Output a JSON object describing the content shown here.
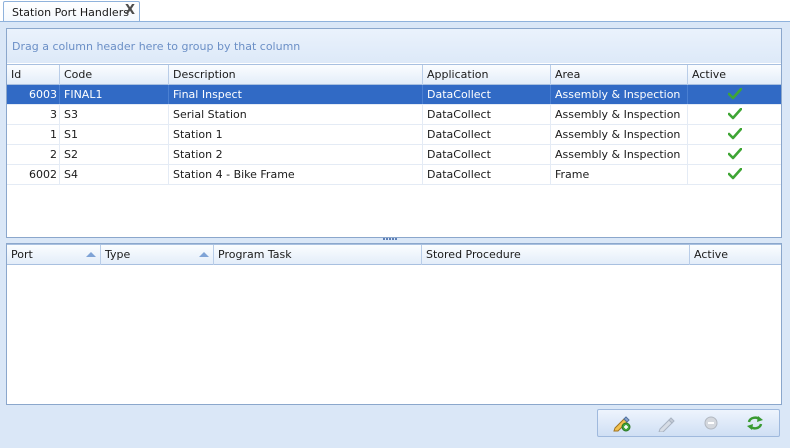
{
  "tab": {
    "title": "Station Port Handlers",
    "close_glyph": "X"
  },
  "group_panel": {
    "hint": "Drag a column header here to group by that column"
  },
  "master_grid": {
    "columns": [
      "Id",
      "Code",
      "Description",
      "Application",
      "Area",
      "Active"
    ],
    "rows": [
      {
        "id": "6003",
        "code": "FINAL1",
        "description": "Final Inspect",
        "application": "DataCollect",
        "area": "Assembly & Inspection",
        "active": true,
        "selected": true
      },
      {
        "id": "3",
        "code": "S3",
        "description": "Serial Station",
        "application": "DataCollect",
        "area": "Assembly & Inspection",
        "active": true
      },
      {
        "id": "1",
        "code": "S1",
        "description": "Station 1",
        "application": "DataCollect",
        "area": "Assembly & Inspection",
        "active": true
      },
      {
        "id": "2",
        "code": "S2",
        "description": "Station 2",
        "application": "DataCollect",
        "area": "Assembly & Inspection",
        "active": true
      },
      {
        "id": "6002",
        "code": "S4",
        "description": "Station 4 - Bike Frame",
        "application": "DataCollect",
        "area": "Frame",
        "active": true
      }
    ]
  },
  "detail_grid": {
    "columns": [
      "Port",
      "Type",
      "Program Task",
      "Stored Procedure",
      "Active"
    ],
    "sorted_columns": [
      "Port",
      "Type"
    ]
  },
  "toolbar": {
    "buttons": [
      {
        "name": "add-icon",
        "enabled": true
      },
      {
        "name": "edit-icon",
        "enabled": false
      },
      {
        "name": "remove-icon",
        "enabled": false
      },
      {
        "name": "refresh-icon",
        "enabled": true
      }
    ]
  },
  "colors": {
    "selection": "#316ac5",
    "frame": "#dae7f7",
    "hint_text": "#6b8fc6",
    "check_green": "#3fa535"
  }
}
